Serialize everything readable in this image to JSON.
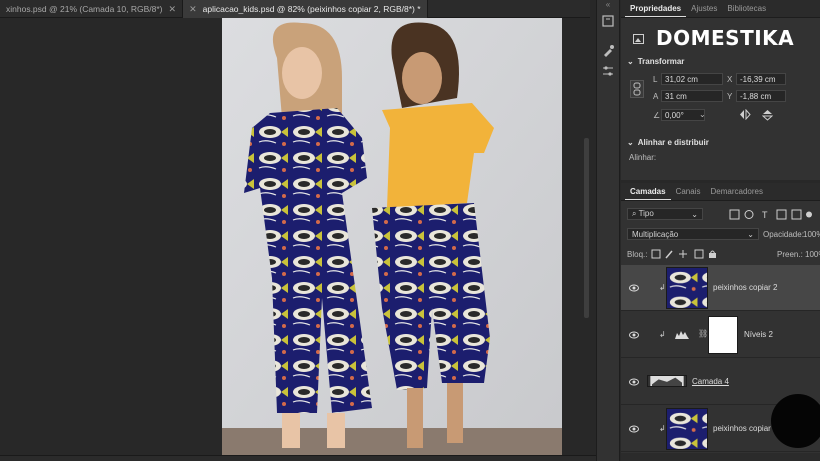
{
  "tabs": [
    {
      "label": "xinhos.psd @ 21% (Camada 10, RGB/8*)",
      "active": false
    },
    {
      "label": "aplicacao_kids.psd @ 82% (peixinhos copiar 2, RGB/8*) *",
      "active": true
    }
  ],
  "properties_panel": {
    "tabs": [
      "Propriedades",
      "Ajustes",
      "Bibliotecas"
    ],
    "brand_watermark": "DOMESTIKA",
    "transform": {
      "title": "Transformar",
      "w_label": "L",
      "w": "31,02 cm",
      "h_label": "A",
      "h": "31 cm",
      "x_label": "X",
      "x": "-16,39 cm",
      "y_label": "Y",
      "y": "-1,88 cm",
      "angle": "0,00°"
    },
    "align": {
      "title": "Alinhar e distribuir",
      "label": "Alinhar:"
    }
  },
  "layers_panel": {
    "tabs": [
      "Camadas",
      "Canais",
      "Demarcadores"
    ],
    "filter": "Tipo",
    "blend_mode": "Multiplicação",
    "opacity_label": "Opacidade:",
    "opacity": "100%",
    "lock_label": "Bloq.:",
    "fill_label": "Preen.:",
    "fill": "100%",
    "layers": [
      {
        "name": "peixinhos copiar 2",
        "selected": true,
        "clipped": true
      },
      {
        "name": "Níveis 2",
        "selected": false,
        "clipped": true
      },
      {
        "name": "Camada 4",
        "selected": false,
        "clipped": false
      },
      {
        "name": "peixinhos copiar",
        "selected": false,
        "clipped": true
      }
    ]
  },
  "colors": {
    "accent": "#ffffff",
    "panel": "#323232",
    "selected_row": "#474747",
    "fish_fabric": "#1c1e6e",
    "shirt": "#f2b33a"
  }
}
